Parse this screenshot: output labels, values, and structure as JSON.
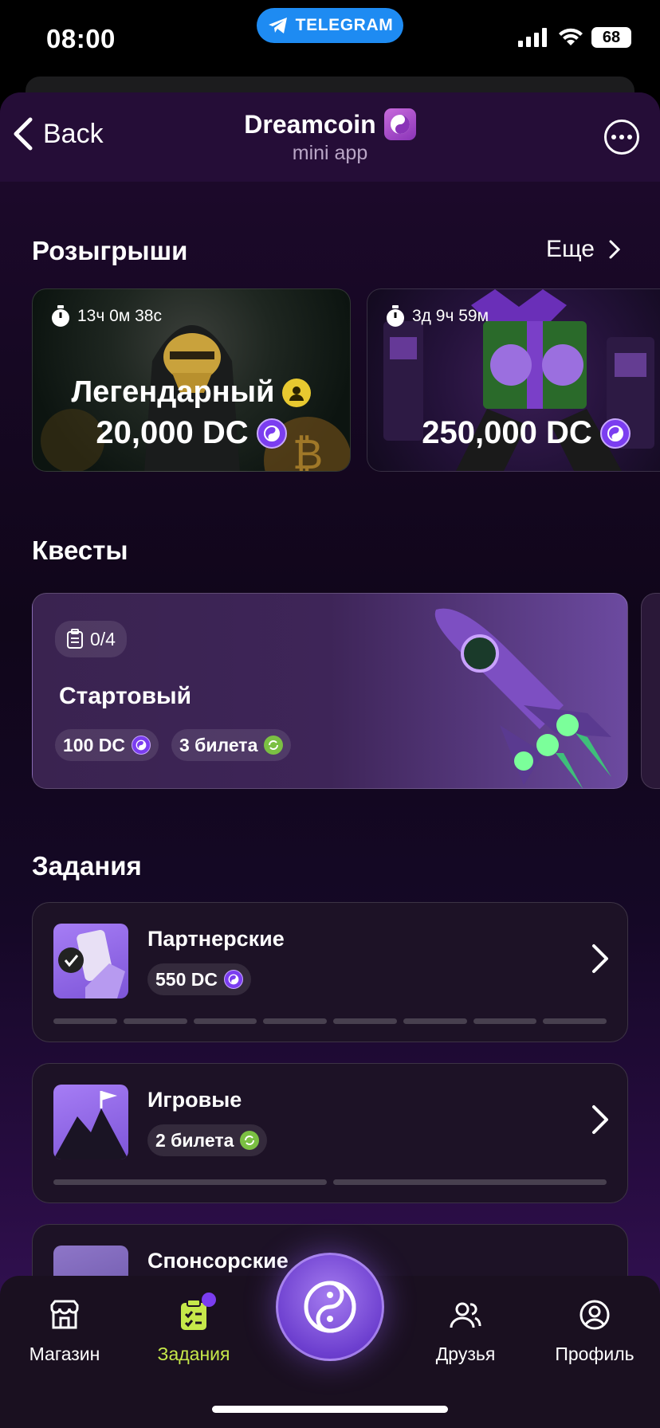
{
  "status_bar": {
    "time": "08:00",
    "telegram_label": "TELEGRAM",
    "battery": "68"
  },
  "header": {
    "back_label": "Back",
    "title": "Dreamcoin",
    "subtitle": "mini app"
  },
  "draws": {
    "title": "Розыгрыши",
    "more_label": "Еще",
    "cards": [
      {
        "timer": "13ч 0м 38с",
        "name": "Легендарный",
        "prize": "20,000 DC"
      },
      {
        "timer": "3д 9ч 59м",
        "prize": "250,000 DC"
      }
    ]
  },
  "quests": {
    "title": "Квесты",
    "card": {
      "progress": "0/4",
      "name": "Стартовый",
      "reward_dc": "100 DC",
      "reward_tickets": "3 билета"
    }
  },
  "tasks": {
    "title": "Задания",
    "items": [
      {
        "name": "Партнерские",
        "reward": "550 DC"
      },
      {
        "name": "Игровые",
        "reward": "2 билета"
      },
      {
        "name": "Спонсорские"
      }
    ]
  },
  "tabbar": {
    "items": [
      {
        "label": "Магазин",
        "icon": "store-icon"
      },
      {
        "label": "Задания",
        "icon": "tasks-icon",
        "active": true
      },
      {
        "label": "Друзья",
        "icon": "friends-icon"
      },
      {
        "label": "Профиль",
        "icon": "profile-icon"
      }
    ],
    "center_icon": "yin-yang-icon"
  },
  "colors": {
    "accent": "#7b3df0",
    "active_tab": "#c6e84a",
    "ticket": "#7bc043",
    "telegram": "#1e8bf2"
  }
}
